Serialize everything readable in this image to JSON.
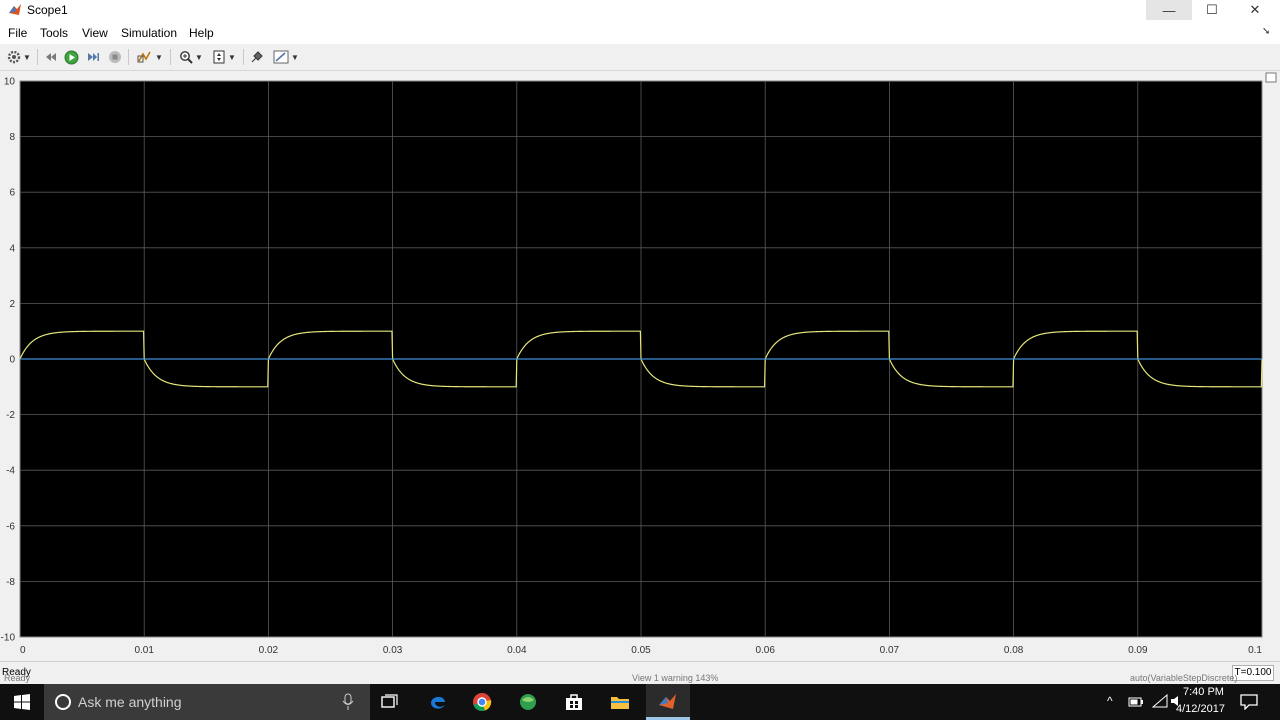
{
  "window": {
    "title": "Scope1"
  },
  "window_controls": {
    "minimize": "—",
    "maximize": "☐",
    "close": "✕"
  },
  "menu": [
    "File",
    "Tools",
    "View",
    "Simulation",
    "Help"
  ],
  "toolbar_icons": [
    "gear-icon",
    "step-back-icon",
    "run-icon",
    "step-forward-icon",
    "stop-icon",
    "highlight-icon",
    "zoom-icon",
    "autoscale-icon",
    "style-icon",
    "measure-icon"
  ],
  "chart_data": {
    "type": "line",
    "xlim": [
      0,
      0.1
    ],
    "ylim": [
      -10,
      10
    ],
    "xticks": [
      "0",
      "0.01",
      "0.02",
      "0.03",
      "0.04",
      "0.05",
      "0.06",
      "0.07",
      "0.08",
      "0.09",
      "0.1"
    ],
    "yticks": [
      "10",
      "8",
      "6",
      "4",
      "2",
      "0",
      "-2",
      "-4",
      "-6",
      "-8",
      "-10"
    ],
    "grid": true,
    "background": "#000000",
    "series": [
      {
        "color": "#e6e67a",
        "shape": "square-wave-rc-response",
        "amplitude": 1,
        "period": 0.02,
        "time_constant": 0.001
      },
      {
        "color": "#3f8fd9",
        "shape": "constant",
        "value": 0
      }
    ]
  },
  "status": {
    "text": "Ready",
    "time": "T=0.100"
  },
  "taskbar": {
    "search_placeholder": "Ask me anything",
    "clock_time": "7:40 PM",
    "clock_date": "4/12/2017",
    "ghost_left": "Ready",
    "ghost_center": "View 1 warning   143%",
    "ghost_right": "auto(VariableStepDiscrete)"
  }
}
